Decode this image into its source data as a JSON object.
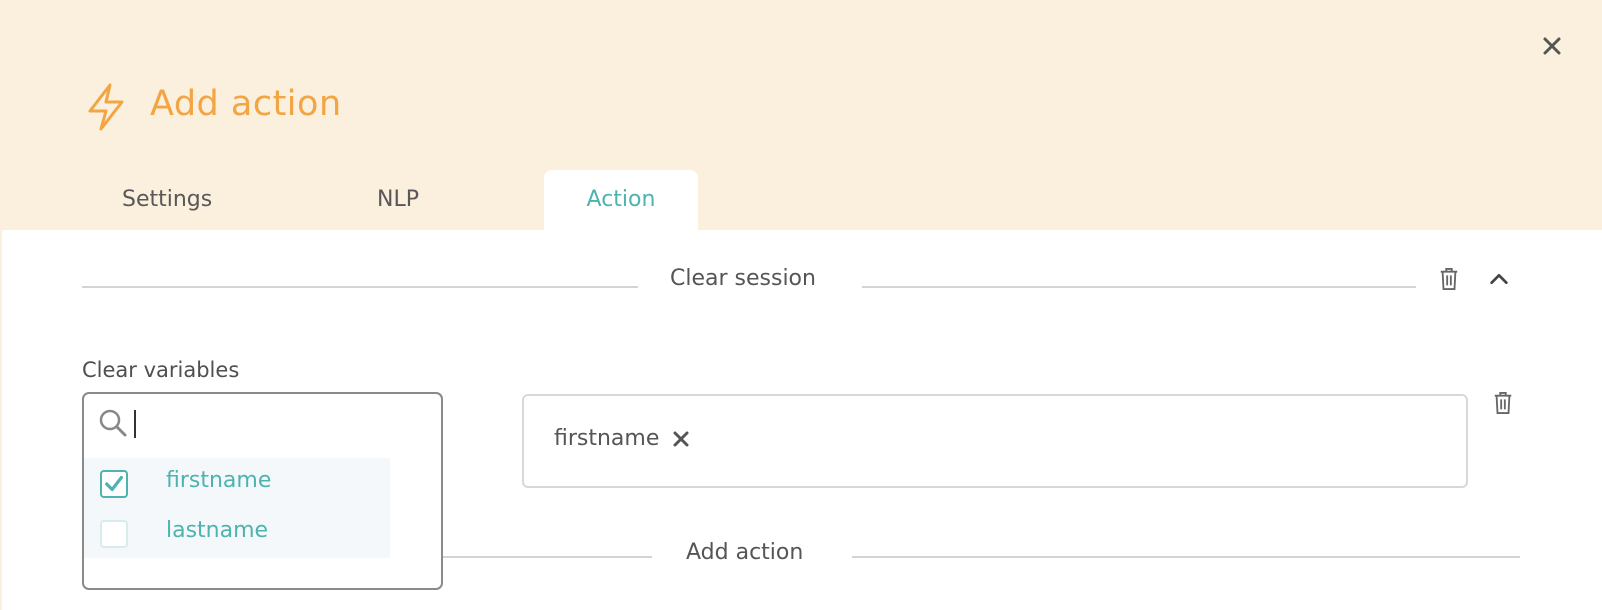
{
  "modal": {
    "title": "Add action",
    "title_icon": "lightning-icon",
    "close_icon": "close-icon"
  },
  "tabs": [
    {
      "label": "Settings",
      "active": false
    },
    {
      "label": "NLP",
      "active": false
    },
    {
      "label": "Action",
      "active": true
    }
  ],
  "action_section": {
    "title": "Clear session",
    "delete_icon": "trash-icon",
    "collapse_icon": "chevron-up-icon",
    "field_label": "Clear variables",
    "search": {
      "value": "",
      "placeholder": ""
    },
    "options": [
      {
        "label": "firstname",
        "checked": true
      },
      {
        "label": "lastname",
        "checked": false
      }
    ],
    "selected_chips": [
      {
        "label": "firstname"
      }
    ]
  },
  "add_action_divider": {
    "label": "Add action"
  },
  "colors": {
    "header_bg": "#fbefdd",
    "accent_orange": "#f2a542",
    "accent_teal": "#4cb3b0",
    "divider": "#d4d4d4"
  }
}
